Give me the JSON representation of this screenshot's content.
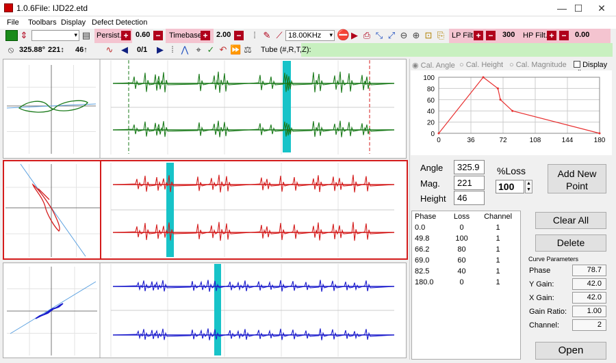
{
  "window": {
    "title": "1.0.6File: IJD22.etd",
    "minimize": "—",
    "maximize": "☐",
    "close": "✕"
  },
  "menu": [
    "File",
    "Toolbars",
    "Display",
    "Defect Detection"
  ],
  "toolbar1": {
    "persist_label": "Persist.",
    "persist_value": "0.60",
    "timebase_label": "Timebase",
    "timebase_value": "2.00",
    "freq": "18.00KHz",
    "lp_label": "LP Filt.",
    "lp_value": "300",
    "hp_label": "HP Filt.",
    "hp_value": "0.00"
  },
  "toolbar2": {
    "angle": "325.88°",
    "mag": "221↕",
    "height": "46↑",
    "page": "0/1",
    "tube": "Tube (#,R,T,Z):"
  },
  "cal": {
    "angle": "Cal. Angle",
    "height": "Cal. Height",
    "magnitude": "Cal. Magnitude",
    "display_all": "Display all"
  },
  "chart_data": {
    "type": "line",
    "x": [
      0,
      49.8,
      66.2,
      69.0,
      82.5,
      180.0
    ],
    "y": [
      0,
      100,
      80,
      60,
      40,
      0
    ],
    "xticks": [
      "0",
      "36",
      "72",
      "108",
      "144",
      "180"
    ],
    "yticks": [
      "0",
      "20",
      "40",
      "60",
      "80",
      "100"
    ],
    "xlim": [
      0,
      180
    ],
    "ylim": [
      0,
      100
    ],
    "grid": true,
    "color": "#e83030"
  },
  "readout": {
    "angle_label": "Angle",
    "angle_value": "325.9",
    "mag_label": "Mag.",
    "mag_value": "221",
    "height_label": "Height",
    "height_value": "46",
    "loss_label": "%Loss",
    "loss_value": "100",
    "add_point": "Add New Point"
  },
  "table": {
    "headers": [
      "Phase",
      "Loss",
      "Channel"
    ],
    "rows": [
      [
        "0.0",
        "0",
        "1"
      ],
      [
        "49.8",
        "100",
        "1"
      ],
      [
        "66.2",
        "80",
        "1"
      ],
      [
        "69.0",
        "60",
        "1"
      ],
      [
        "82.5",
        "40",
        "1"
      ],
      [
        "180.0",
        "0",
        "1"
      ]
    ]
  },
  "buttons": {
    "clear_all": "Clear All",
    "delete": "Delete",
    "open": "Open"
  },
  "curve": {
    "title": "Curve Parameters",
    "phase_label": "Phase",
    "phase_value": "78.7",
    "ygain_label": "Y Gain:",
    "ygain_value": "42.0",
    "xgain_label": "X Gain:",
    "xgain_value": "42.0",
    "ratio_label": "Gain Ratio:",
    "ratio_value": "1.00",
    "channel_label": "Channel:",
    "channel_value": "2"
  },
  "colors": {
    "green": "#1a7a1a",
    "red": "#d41c1c",
    "blue": "#1a1acc",
    "cursor": "#17c3c8"
  }
}
